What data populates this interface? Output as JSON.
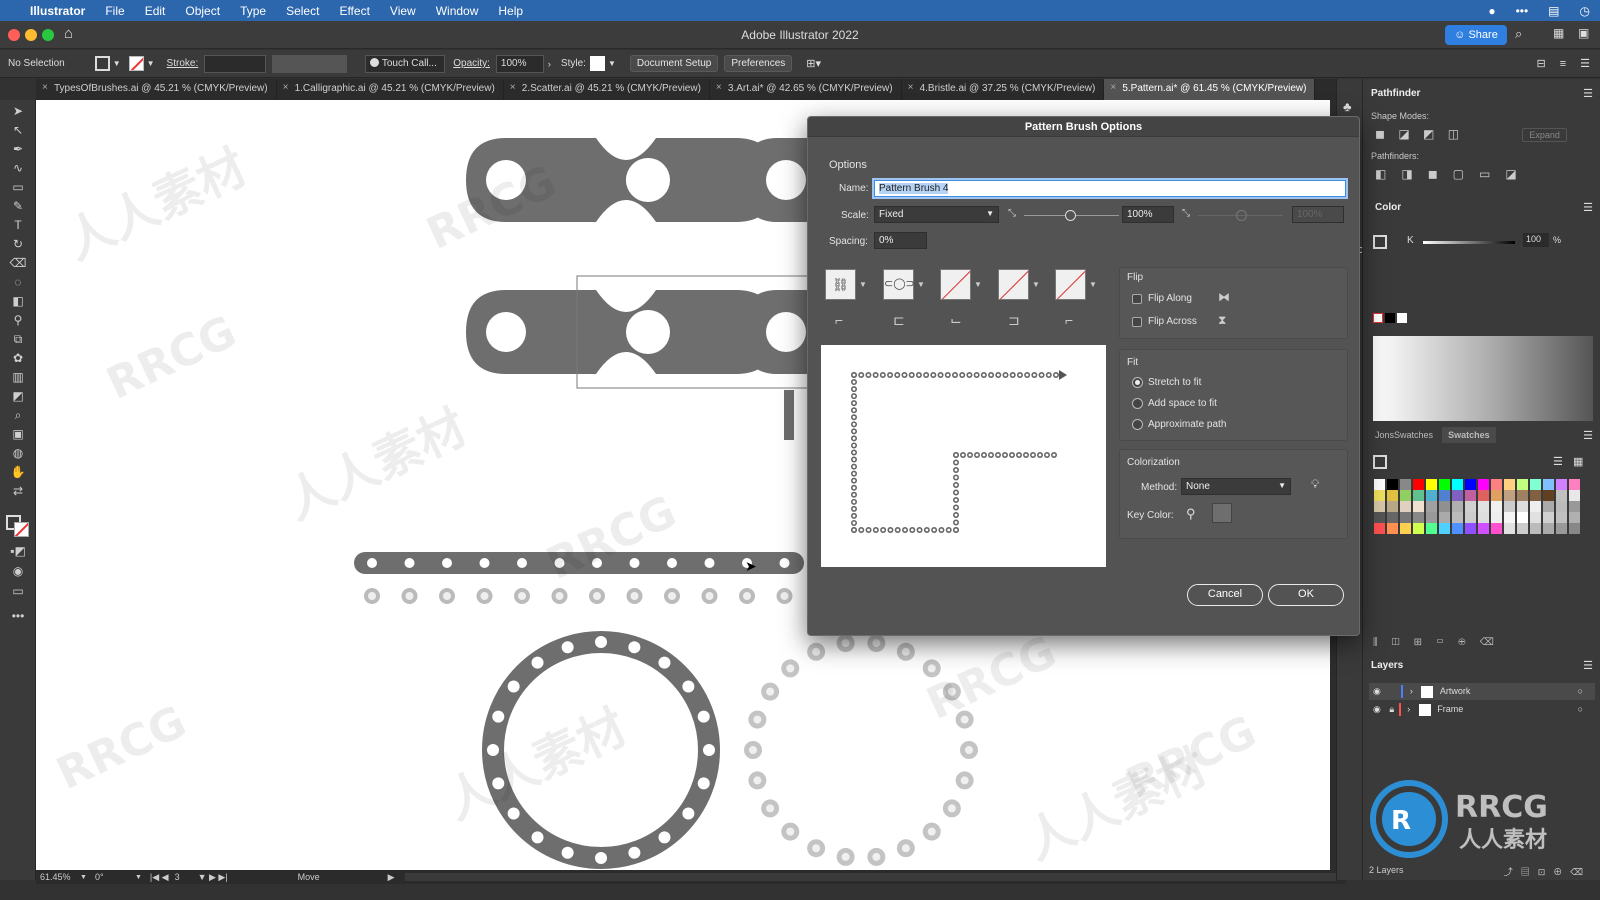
{
  "menubar": {
    "apple": "",
    "items": [
      "Illustrator",
      "File",
      "Edit",
      "Object",
      "Type",
      "Select",
      "Effect",
      "View",
      "Window",
      "Help"
    ]
  },
  "window": {
    "title": "Adobe Illustrator 2022",
    "share_label": "Share"
  },
  "controlbar": {
    "selection": "No Selection",
    "stroke_label": "Stroke:",
    "brush_name": "Touch Call...",
    "opacity_label": "Opacity:",
    "opacity_value": "100%",
    "style_label": "Style:",
    "document_setup": "Document Setup",
    "preferences": "Preferences"
  },
  "tabs": [
    {
      "label": "TypesOfBrushes.ai @ 45.21 % (CMYK/Preview)"
    },
    {
      "label": "1.Calligraphic.ai @ 45.21 % (CMYK/Preview)"
    },
    {
      "label": "2.Scatter.ai @ 45.21 % (CMYK/Preview)"
    },
    {
      "label": "3.Art.ai* @ 42.65 % (CMYK/Preview)"
    },
    {
      "label": "4.Bristle.ai @ 37.25 % (CMYK/Preview)"
    },
    {
      "label": "5.Pattern.ai* @ 61.45 % (CMYK/Preview)"
    }
  ],
  "statusbar": {
    "zoom": "61.45%",
    "rotation": "0°",
    "artboard": "3",
    "tool": "Move"
  },
  "dialog": {
    "title": "Pattern Brush Options",
    "options_header": "Options",
    "name_label": "Name:",
    "name_value": "Pattern Brush 4",
    "scale_label": "Scale:",
    "scale_value": "Fixed",
    "scale_percent": "100%",
    "scale_percent2": "100%",
    "spacing_label": "Spacing:",
    "spacing_value": "0%",
    "flip_header": "Flip",
    "flip_along": "Flip Along",
    "flip_across": "Flip Across",
    "fit_header": "Fit",
    "fit_options": [
      "Stretch to fit",
      "Add space to fit",
      "Approximate path"
    ],
    "fit_selected": 0,
    "colorization_header": "Colorization",
    "method_label": "Method:",
    "method_value": "None",
    "key_color_label": "Key Color:",
    "key_color": "#6e6e6e",
    "cancel": "Cancel",
    "ok": "OK"
  },
  "rightpanel": {
    "pathfinder_tab": "Pathfinder",
    "shape_modes": "Shape Modes:",
    "expand": "Expand",
    "pathfinders": "Pathfinders:",
    "color_tab": "Color",
    "k_label": "K",
    "k_value": "100",
    "k_pct": "%",
    "swatch_tabs": [
      "JonsSwatches",
      "Swatches"
    ],
    "layers_tab": "Layers",
    "layers": [
      {
        "name": "Artwork",
        "color": "#4f7cff"
      },
      {
        "name": "Frame",
        "color": "#ff4f4f"
      }
    ],
    "layers_count": "2 Layers"
  },
  "watermark": {
    "brand": "RRCG",
    "sub": "人人素材"
  },
  "colors": {
    "menubar": "#2c66ad",
    "chain": "#6e6e6e",
    "panel": "#3a3a3a",
    "dialog": "#535353"
  }
}
